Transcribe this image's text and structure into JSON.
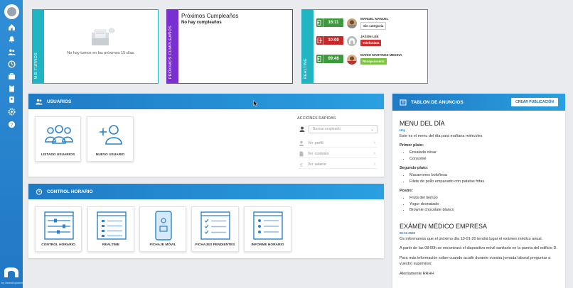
{
  "brand": {
    "footer": "by hamshoponee"
  },
  "top_cards": {
    "turnos": {
      "label": "MIS TURNOS",
      "empty": "No hay turnos en los próximos 15 días."
    },
    "cumple": {
      "label": "PRÓXIMOS CUMPLEAÑOS",
      "title": "Próximos Cumpleaños",
      "subtitle": "No hay cumpleaños"
    },
    "realtime": {
      "label": "REALTIME",
      "rows": [
        {
          "time": "16:11",
          "name": "MANUEL MANUEL",
          "badge": "Sin categoría",
          "status": "green"
        },
        {
          "time": "10:00",
          "name": "JASON LEE",
          "badge": "Telefonista",
          "status": "red"
        },
        {
          "time": "09:46",
          "name": "MARIO MARTINEZ MEDINA",
          "badge": "Recepcionista",
          "status": "green"
        }
      ]
    }
  },
  "usuarios": {
    "title": "USUARIOS",
    "tiles": [
      "LISTADO USUARIOS",
      "NUEVO USUARIO"
    ],
    "acciones": {
      "title": "ACCIONES RÁPIDAS",
      "search_placeholder": "Buscar empleado",
      "rows": [
        {
          "prefix": "Ver",
          "bold": "perfil"
        },
        {
          "prefix": "Ver",
          "bold": "contrato"
        },
        {
          "prefix": "Ver",
          "bold": "salario"
        }
      ]
    }
  },
  "control": {
    "title": "CONTROL HORARIO",
    "tiles": [
      "CONTROL HORARIO",
      "REALTIME",
      "FICHAJE MÓVIL",
      "FICHAJES PENDIENTES",
      "INFORME HORARIO"
    ]
  },
  "tablon": {
    "title": "TABLON DE ANUNCIOS",
    "create_button": "CREAR PUBLICACIÓN",
    "ann1": {
      "title": "MENU DEL DÍA",
      "date": "Hoy",
      "intro": "Este es el menu del día para mañana miércoles",
      "s1": "Primer plato:",
      "s1_items": [
        "Ensalada césar",
        "Consomé"
      ],
      "s2": "Segundo plato:",
      "s2_items": [
        "Macarrones boloñesa",
        "Filete de pollo empanado con patatas fritas"
      ],
      "s3": "Postre:",
      "s3_items": [
        "Fruta del tiempo",
        "Yogur desnatado",
        "Brownie chocolate blanco"
      ]
    },
    "ann2": {
      "title": "EXÁMEN MÉDICO EMPRESA",
      "date": "06-01-2020",
      "p1": "Os informamos que el próximo día 10-01-20 tendrá lugar el exámen médico anual.",
      "p2": "A partir de las 08:00h se encontrará el dispositivo móvil sanitario en la puerta del edificio D.",
      "p3": "Para más información sobre cuando acudir durante vuestra jornada laboral preguntar a vuestro supervisor.",
      "p4": "Atentamente RRHH"
    }
  },
  "colors": {
    "accent": "#2a8ad4",
    "turnos": "#21b5c4",
    "cumple": "#7a2fd1"
  }
}
